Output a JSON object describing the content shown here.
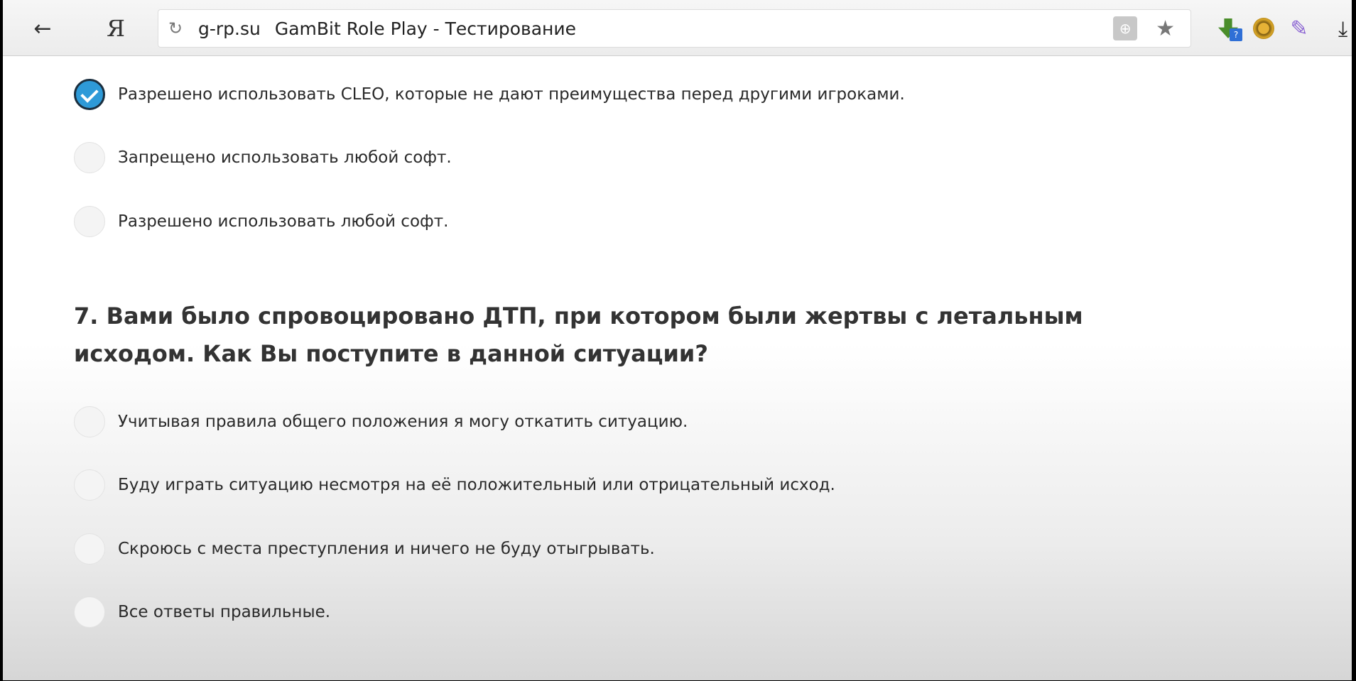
{
  "browser": {
    "back_icon": "arrow-left-icon",
    "yandex_label": "Я",
    "reload_icon": "reload-icon",
    "address_host": "g-rp.su",
    "page_title": "GamBit Role Play - Тестирование",
    "translate_icon": "globe-icon",
    "bookmark_icon": "star-icon",
    "extensions": [
      "download-saver-icon",
      "coin-extension-icon",
      "pen-extension-icon"
    ],
    "download_icon": "download-icon"
  },
  "question_6": {
    "options": [
      {
        "label": "Разрешено использовать CLEO, которые не дают преимущества перед другими игроками.",
        "checked": true
      },
      {
        "label": "Запрещено использовать любой софт.",
        "checked": false
      },
      {
        "label": "Разрешено использовать любой софт.",
        "checked": false
      }
    ]
  },
  "question_7": {
    "text": "7. Вами было спровоцировано ДТП, при котором были жертвы с летальным исходом. Как Вы поступите в данной ситуации?",
    "options": [
      {
        "label": "Учитывая правила общего положения я могу откатить ситуацию.",
        "checked": false
      },
      {
        "label": "Буду играть ситуацию несмотря на её положительный или отрицательный исход.",
        "checked": false
      },
      {
        "label": "Скроюсь с места преступления и ничего не буду отыгрывать.",
        "checked": false
      },
      {
        "label": "Все ответы правильные.",
        "checked": false
      }
    ]
  },
  "colors": {
    "accent": "#2e9ad8",
    "text": "#2a2a2a",
    "heading": "#333333"
  }
}
